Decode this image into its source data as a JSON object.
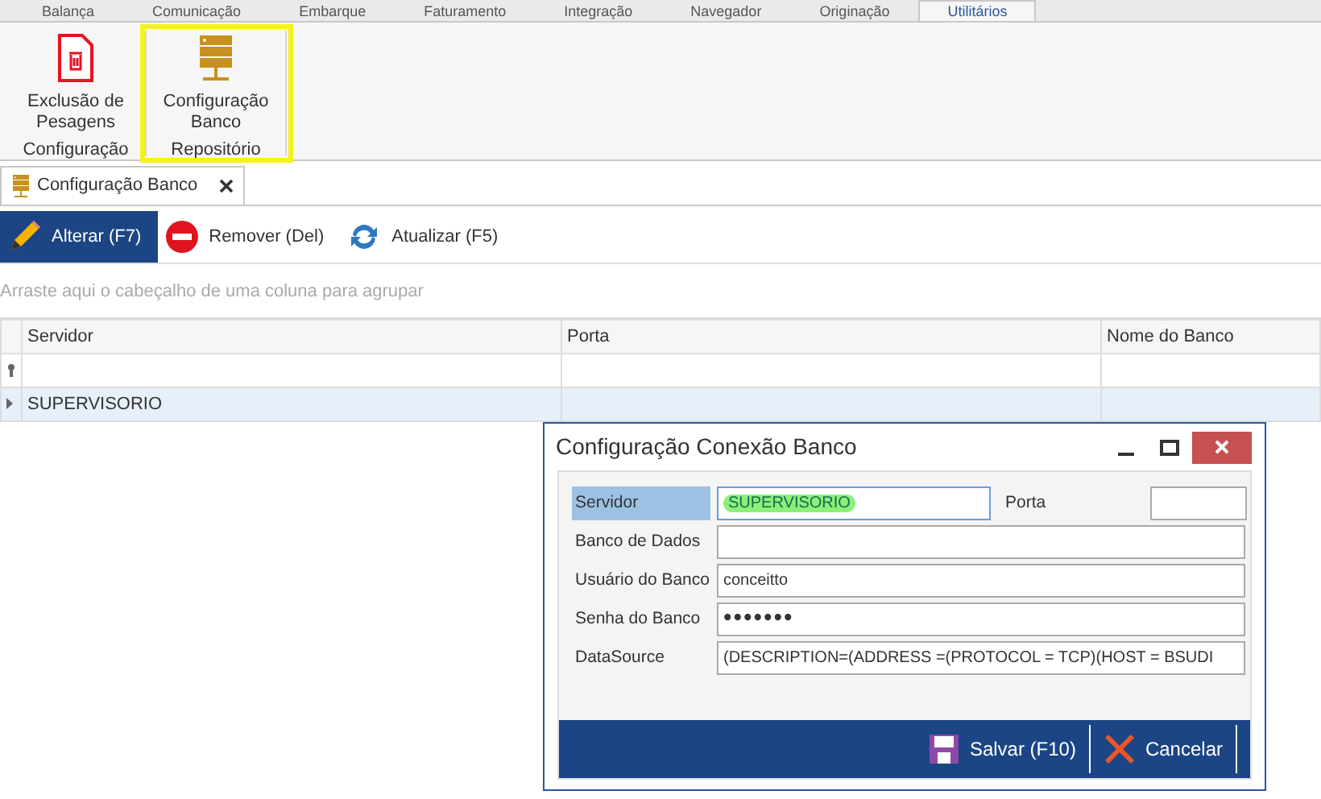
{
  "ribbon_tabs": [
    {
      "label": "Balança",
      "selected": false
    },
    {
      "label": "Comunicação",
      "selected": false
    },
    {
      "label": "Embarque",
      "selected": false
    },
    {
      "label": "Faturamento",
      "selected": false
    },
    {
      "label": "Integração",
      "selected": false
    },
    {
      "label": "Navegador",
      "selected": false
    },
    {
      "label": "Originação",
      "selected": false
    },
    {
      "label": "Utilitários",
      "selected": true
    }
  ],
  "ribbon_groups": [
    {
      "label": "Configuração",
      "highlighted": false,
      "buttons": [
        {
          "label": "Exclusão de Pesagens",
          "kind": "delete"
        }
      ]
    },
    {
      "label": "Repositório",
      "highlighted": true,
      "buttons": [
        {
          "label": "Configuração Banco",
          "kind": "server"
        }
      ]
    }
  ],
  "document_tab": {
    "label": "Configuração Banco"
  },
  "toolbar": [
    {
      "label": "Alterar (F7)",
      "kind": "edit",
      "selected": true
    },
    {
      "label": "Remover (Del)",
      "kind": "remove",
      "selected": false
    },
    {
      "label": "Atualizar (F5)",
      "kind": "refresh",
      "selected": false
    }
  ],
  "group_panel": {
    "placeholder": "Arraste aqui o cabeçalho de uma coluna para agrupar"
  },
  "table": {
    "columns": [
      "Servidor",
      "Porta",
      "Nome do Banco"
    ],
    "rows": [
      {
        "cells": [
          "SUPERVISORIO",
          "",
          ""
        ],
        "selected": true
      }
    ]
  },
  "dialog": {
    "title": "Configuração Conexão Banco",
    "fields": [
      {
        "label": "Servidor",
        "value": "SUPERVISORIO",
        "focused": true,
        "highlighted": true
      },
      {
        "label": "Porta"
      },
      {
        "label": "Banco de Dados"
      },
      {
        "label": "Usuário do Banco",
        "value": "conceitto"
      },
      {
        "label": "Senha do Banco",
        "value": "•••••••",
        "kind": "password"
      },
      {
        "label": "DataSource",
        "value": "(DESCRIPTION=(ADDRESS =(PROTOCOL = TCP)(HOST = BSUDI"
      }
    ],
    "buttons": [
      {
        "label": "Salvar (F10)",
        "kind": "save"
      },
      {
        "label": "Cancelar",
        "kind": "cancel"
      }
    ]
  }
}
